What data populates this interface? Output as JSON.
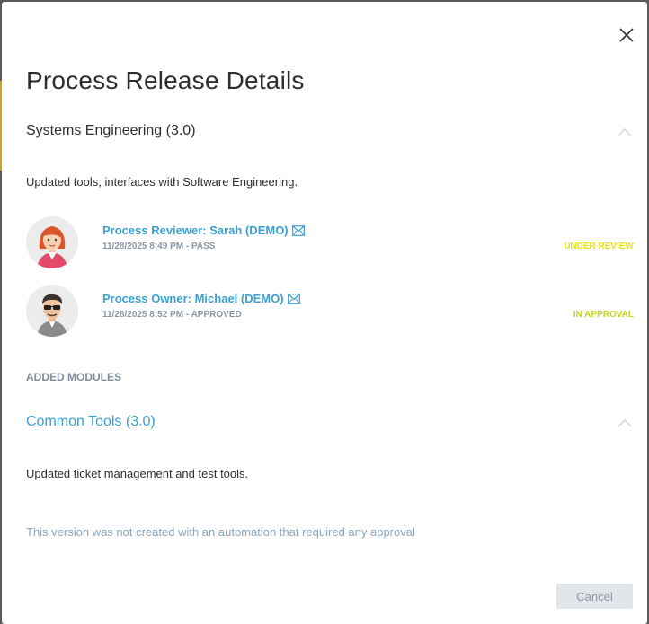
{
  "dialog": {
    "title": "Process Release Details",
    "close_label": "close"
  },
  "section1": {
    "title": "Systems Engineering (3.0)",
    "description": "Updated tools, interfaces with Software Engineering.",
    "approvals": [
      {
        "name": "Process Reviewer: Sarah (DEMO)",
        "meta": "11/28/2025 8:49 PM - PASS",
        "status": "UNDER REVIEW",
        "status_color": "#e6e21e",
        "avatar": "female-avatar"
      },
      {
        "name": "Process Owner: Michael (DEMO)",
        "meta": "11/28/2025 8:52 PM - APPROVED",
        "status": "IN APPROVAL",
        "status_color": "#c8d21e",
        "avatar": "male-avatar"
      }
    ]
  },
  "added_modules_label": "ADDED MODULES",
  "section2": {
    "title": "Common Tools (3.0)",
    "description": "Updated ticket management and test tools."
  },
  "note": "This version was not created with an automation that required any approval",
  "footer": {
    "cancel_label": "Cancel"
  },
  "colors": {
    "accent": "#3aa0d0",
    "text": "#2b2f33",
    "muted": "#8a97a3"
  }
}
